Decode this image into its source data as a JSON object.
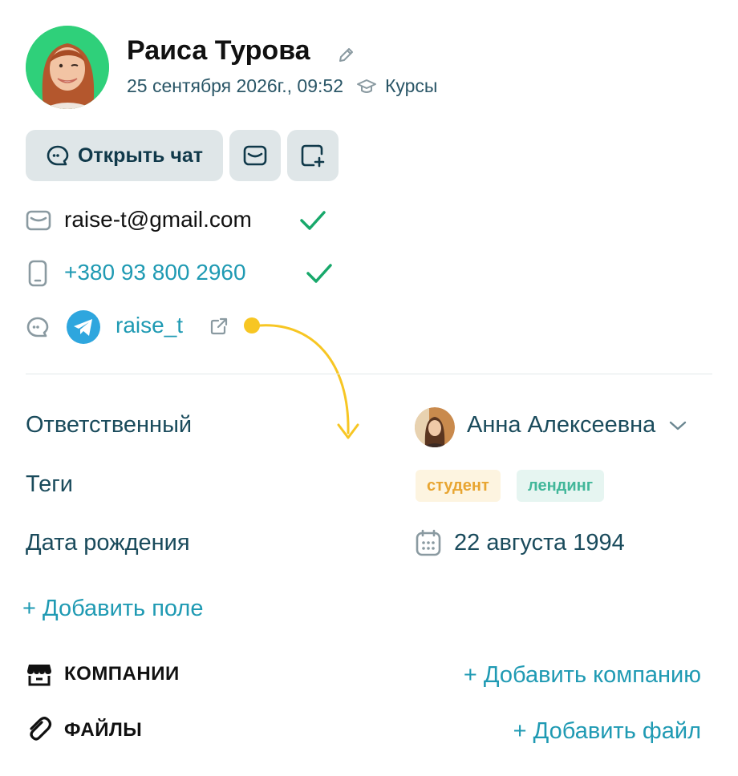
{
  "contact": {
    "name": "Раиса Турова",
    "datetime": "25 сентября 2026г., 09:52",
    "source": "Курсы",
    "email": "raise-t@gmail.com",
    "phone": "+380 93 800 2960",
    "telegram": "raise_t"
  },
  "actions": {
    "open_chat": "Открыть чат"
  },
  "fields": {
    "responsible_label": "Ответственный",
    "responsible_value": "Анна Алексеевна",
    "tags_label": "Теги",
    "tags": [
      "студент",
      "лендинг"
    ],
    "birthday_label": "Дата рождения",
    "birthday_value": "22 августа 1994",
    "add_field": "+ Добавить поле"
  },
  "sections": {
    "companies": "КОМПАНИИ",
    "add_company": "+ Добавить компанию",
    "files": "ФАЙЛЫ",
    "add_file": "+ Добавить файл"
  },
  "colors": {
    "accent": "#1f9ab3",
    "verified": "#18a86b",
    "annotation": "#f7c623",
    "tag_student_bg": "#fdf4e0",
    "tag_student_fg": "#e8a531",
    "tag_landing_bg": "#e6f5f1",
    "tag_landing_fg": "#42b79a"
  }
}
